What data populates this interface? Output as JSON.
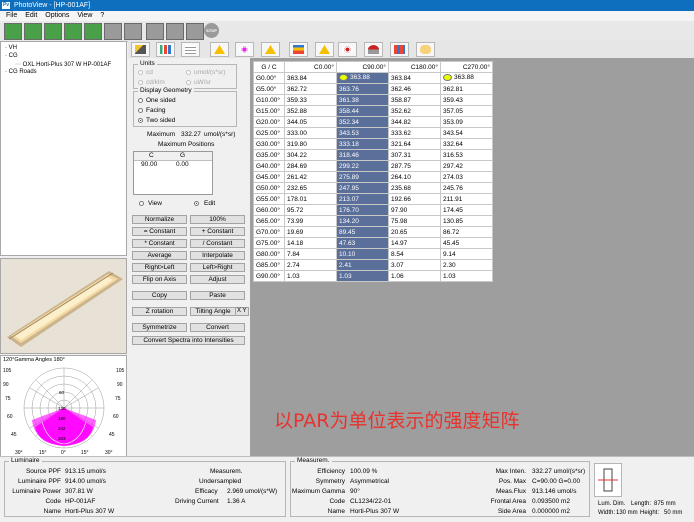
{
  "window": {
    "title": "PhotoView - [HP-001AF]",
    "app_icon": "Pv"
  },
  "menu": [
    "File",
    "Edit",
    "Options",
    "View",
    "?"
  ],
  "toolbar": {
    "stop_label": "STOP"
  },
  "tree": {
    "root": "VH",
    "cg": "CG",
    "item": "OXL Horti-Plus 307 W HP-001AF",
    "roads": "CG Roads"
  },
  "units": {
    "title": "Units",
    "options": [
      "cd",
      "umol/(s*sr)",
      "cd/klm",
      "uW/sr"
    ]
  },
  "display_geometry": {
    "title": "Display Geometry",
    "options": [
      "One sided",
      "Facing",
      "Two sided"
    ],
    "selected": "Two sided"
  },
  "maximum": {
    "label": "Maximum",
    "value": "332.27",
    "unit": "umol/(s*sr)"
  },
  "max_positions": {
    "title": "Maximum Positions",
    "col_c": "C",
    "col_g": "G",
    "c_value": "90.00",
    "g_value": "0.00"
  },
  "mode": {
    "view": "View",
    "edit": "Edit",
    "selected": "Edit"
  },
  "buttons": {
    "normalize": "Normalize",
    "pct100": "100%",
    "eq_constant": "= Constant",
    "plus_constant": "+ Constant",
    "mul_constant": "* Constant",
    "div_constant": "/ Constant",
    "average": "Average",
    "interpolate": "Interpolate",
    "right_left": "Right>Left",
    "left_right": "Left>Right",
    "flip_axis": "Flip on Axis",
    "adjust": "Adjust",
    "copy": "Copy",
    "paste": "Paste",
    "z_rotation": "Z rotation",
    "tilting_angle": "Tilting Angle",
    "tilting_axes": "X Y",
    "symmetrize": "Symmetrize",
    "convert": "Convert",
    "convert_spectra": "Convert Spectra into Intensities"
  },
  "grid": {
    "corner": "G  /  C",
    "columns": [
      "C0.00°",
      "C90.00°",
      "C180.00°",
      "C270.00°"
    ],
    "rows": [
      {
        "g": "G0.00°",
        "v": [
          "363.84",
          "363.88",
          "363.84",
          "363.88"
        ]
      },
      {
        "g": "G5.00°",
        "v": [
          "362.72",
          "363.76",
          "362.46",
          "362.81"
        ]
      },
      {
        "g": "G10.00°",
        "v": [
          "359.33",
          "361.38",
          "358.87",
          "359.43"
        ]
      },
      {
        "g": "G15.00°",
        "v": [
          "352.88",
          "358.44",
          "352.62",
          "357.05"
        ]
      },
      {
        "g": "G20.00°",
        "v": [
          "344.05",
          "352.34",
          "344.82",
          "353.09"
        ]
      },
      {
        "g": "G25.00°",
        "v": [
          "333.00",
          "343.53",
          "333.62",
          "343.54"
        ]
      },
      {
        "g": "G30.00°",
        "v": [
          "319.80",
          "333.18",
          "321.64",
          "332.64"
        ]
      },
      {
        "g": "G35.00°",
        "v": [
          "304.22",
          "318.46",
          "307.31",
          "316.53"
        ]
      },
      {
        "g": "G40.00°",
        "v": [
          "284.69",
          "299.22",
          "287.75",
          "297.42"
        ]
      },
      {
        "g": "G45.00°",
        "v": [
          "261.42",
          "275.89",
          "264.10",
          "274.03"
        ]
      },
      {
        "g": "G50.00°",
        "v": [
          "232.65",
          "247.95",
          "235.68",
          "245.76"
        ]
      },
      {
        "g": "G55.00°",
        "v": [
          "178.01",
          "213.07",
          "192.66",
          "211.91"
        ]
      },
      {
        "g": "G60.00°",
        "v": [
          "95.72",
          "176.70",
          "97.90",
          "174.45"
        ]
      },
      {
        "g": "G65.00°",
        "v": [
          "73.99",
          "134.20",
          "75.98",
          "130.85"
        ]
      },
      {
        "g": "G70.00°",
        "v": [
          "19.69",
          "89.45",
          "20.65",
          "86.72"
        ]
      },
      {
        "g": "G75.00°",
        "v": [
          "14.18",
          "47.63",
          "14.97",
          "45.45"
        ]
      },
      {
        "g": "G80.00°",
        "v": [
          "7.84",
          "10.10",
          "8.54",
          "9.14"
        ]
      },
      {
        "g": "G85.00°",
        "v": [
          "2.74",
          "2.41",
          "3.07",
          "2.30"
        ]
      },
      {
        "g": "G90.00°",
        "v": [
          "1.03",
          "1.03",
          "1.06",
          "1.03"
        ]
      }
    ]
  },
  "caption": "以PAR为单位表示的强度矩阵",
  "polar": {
    "header": "120°Gamma Angles  180°",
    "rings": [
      "405",
      "360",
      "315",
      "270",
      "225",
      "180",
      "135",
      "90",
      "45"
    ],
    "labels_left": [
      "105",
      "90",
      "75",
      "60",
      "45"
    ],
    "labels_right": [
      "105",
      "90",
      "75",
      "60",
      "45"
    ],
    "inner_values": [
      "60",
      "120",
      "180",
      "242",
      "303"
    ],
    "bottom_labels": [
      "30°",
      "15°",
      "0°",
      "15°",
      "30°"
    ]
  },
  "luminaire": {
    "title": "Luminaire",
    "source_ppf_label": "Source PPF",
    "source_ppf": "913.15 umol/s",
    "lum_ppf_label": "Luminaire PPF",
    "lum_ppf": "914.00 umol/s",
    "lum_power_label": "Luminaire Power",
    "lum_power": "307.81 W",
    "code_label": "Code",
    "code": "HP-001AF",
    "name_label": "Name",
    "name": "Horti-Plus 307 W",
    "measurem_label": "Measurem.",
    "measurem": "Undersampled",
    "efficacy_label": "Efficacy",
    "efficacy": "2.969 umol/(s*W)",
    "driving_label": "Driving Current",
    "driving": "1.36 A"
  },
  "measurement": {
    "title": "Measurem.",
    "efficiency_label": "Efficiency",
    "efficiency": "100.09 %",
    "symmetry_label": "Symmetry",
    "symmetry": "Asymmetrical",
    "max_gamma_label": "Maximum Gamma",
    "max_gamma": "90°",
    "code_label": "Code",
    "code": "CL1234/22-01",
    "name_label": "Name",
    "name": "Horti-Plus 307 W",
    "max_inten_label": "Max Inten.",
    "max_inten": "332.27 umol/(s*sr)",
    "pos_max_label": "Pos. Max",
    "pos_max": "C=90.00 G=0.00",
    "meas_flux_label": "Meas.Flux",
    "meas_flux": "913.146 umol/s",
    "frontal_label": "Frontal Area",
    "frontal": "0.093500 m2",
    "side_label": "Side Area",
    "side": "0.000000 m2"
  },
  "dims": {
    "lum_dim_label": "Lum. Dim.",
    "length_label": "Length:",
    "length": "875 mm",
    "width_label": "Width:",
    "width": "130 mm",
    "height_label": "Height:",
    "height": "50 mm"
  },
  "colors": {
    "titlebar": "#0f6fbf",
    "selected_col": "#5a6f9a",
    "caption": "#e8322d",
    "polar_fill": "#ff00ff"
  }
}
